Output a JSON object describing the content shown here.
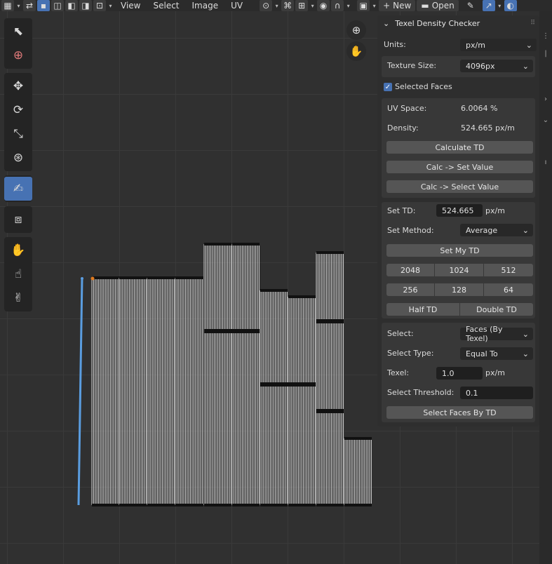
{
  "header": {
    "menu": [
      "View",
      "Select",
      "Image",
      "UV"
    ],
    "new_label": "New",
    "open_label": "Open"
  },
  "toolbar": {
    "tools": [
      "cursor-icon",
      "annotate-circle-icon",
      "move-icon",
      "rotate-icon",
      "scale-icon",
      "transform-icon",
      "texel-density-icon",
      "rip-icon",
      "grab-icon",
      "relax-icon",
      "pinch-icon"
    ]
  },
  "panel": {
    "title": "Texel Density Checker",
    "units_label": "Units:",
    "units_value": "px/m",
    "texture_size_label": "Texture Size:",
    "texture_size_value": "4096px",
    "selected_faces_label": "Selected Faces",
    "uv_space_label": "UV Space:",
    "uv_space_value": "6.0064 %",
    "density_label": "Density:",
    "density_value": "524.665 px/m",
    "calculate_td": "Calculate TD",
    "calc_set_value": "Calc -> Set Value",
    "calc_select_value": "Calc -> Select Value",
    "set_td_label": "Set TD:",
    "set_td_value": "524.665",
    "set_td_unit": "px/m",
    "set_method_label": "Set Method:",
    "set_method_value": "Average",
    "set_my_td": "Set My TD",
    "presets_row1": [
      "2048",
      "1024",
      "512"
    ],
    "presets_row2": [
      "256",
      "128",
      "64"
    ],
    "half_td": "Half TD",
    "double_td": "Double TD",
    "select_label": "Select:",
    "select_value": "Faces (By Texel)",
    "select_type_label": "Select Type:",
    "select_type_value": "Equal To",
    "texel_label": "Texel:",
    "texel_value": "1.0",
    "texel_unit": "px/m",
    "threshold_label": "Select Threshold:",
    "threshold_value": "0.1",
    "select_faces_by_td": "Select Faces By TD"
  },
  "colors": {
    "accent": "#4772b3",
    "selected_edge": "#5a9de0",
    "active_vertex": "#e07a1f"
  }
}
